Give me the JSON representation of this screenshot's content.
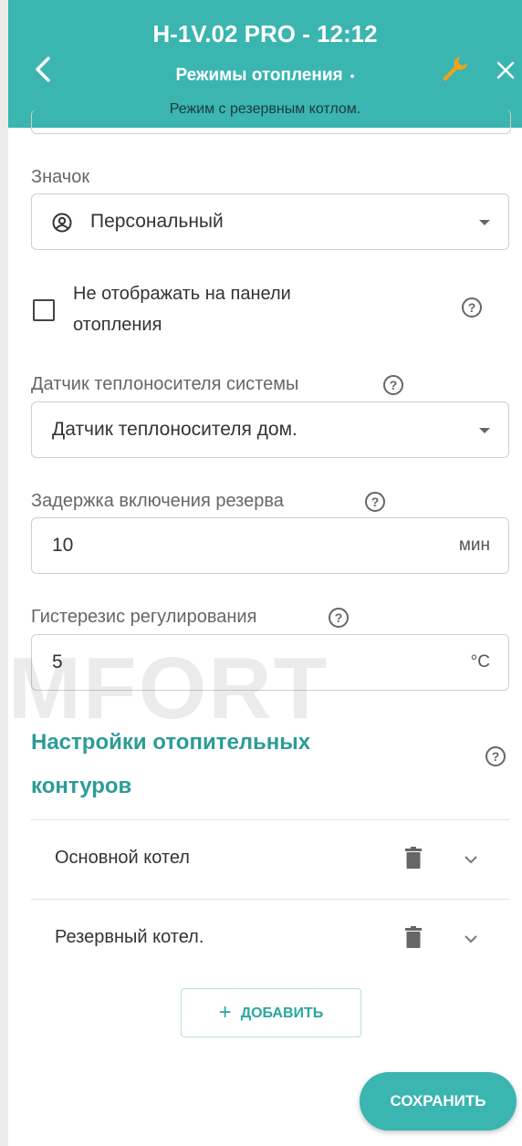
{
  "header": {
    "title": "H-1V.02 PRO  - 12:12",
    "subtitle": "Режимы отопления",
    "subtitle_dot": "•",
    "mode_line": "Режим с резервным котлом."
  },
  "icon_field": {
    "label": "Значок",
    "icon": "person-circle-icon",
    "value": "Персональный"
  },
  "hide_checkbox": {
    "checked": false,
    "label": "Не отображать на панели отопления"
  },
  "sensor_field": {
    "label": "Датчик теплоносителя системы",
    "value": "Датчик теплоносителя дом."
  },
  "delay_field": {
    "label": "Задержка включения резерва",
    "value": "10",
    "unit": "мин"
  },
  "hysteresis_field": {
    "label": "Гистерезис регулирования",
    "value": "5",
    "unit": "°C"
  },
  "watermark": "MFORT",
  "circuits": {
    "title": "Настройки отопительных контуров",
    "items": [
      {
        "label": "Основной котел"
      },
      {
        "label": "Резервный котел."
      }
    ],
    "add_label": "ДОБАВИТЬ"
  },
  "save_label": "СОХРАНИТЬ",
  "help_glyph": "?",
  "colors": {
    "accent": "#3ab5b0",
    "section_title": "#2c9c98"
  }
}
